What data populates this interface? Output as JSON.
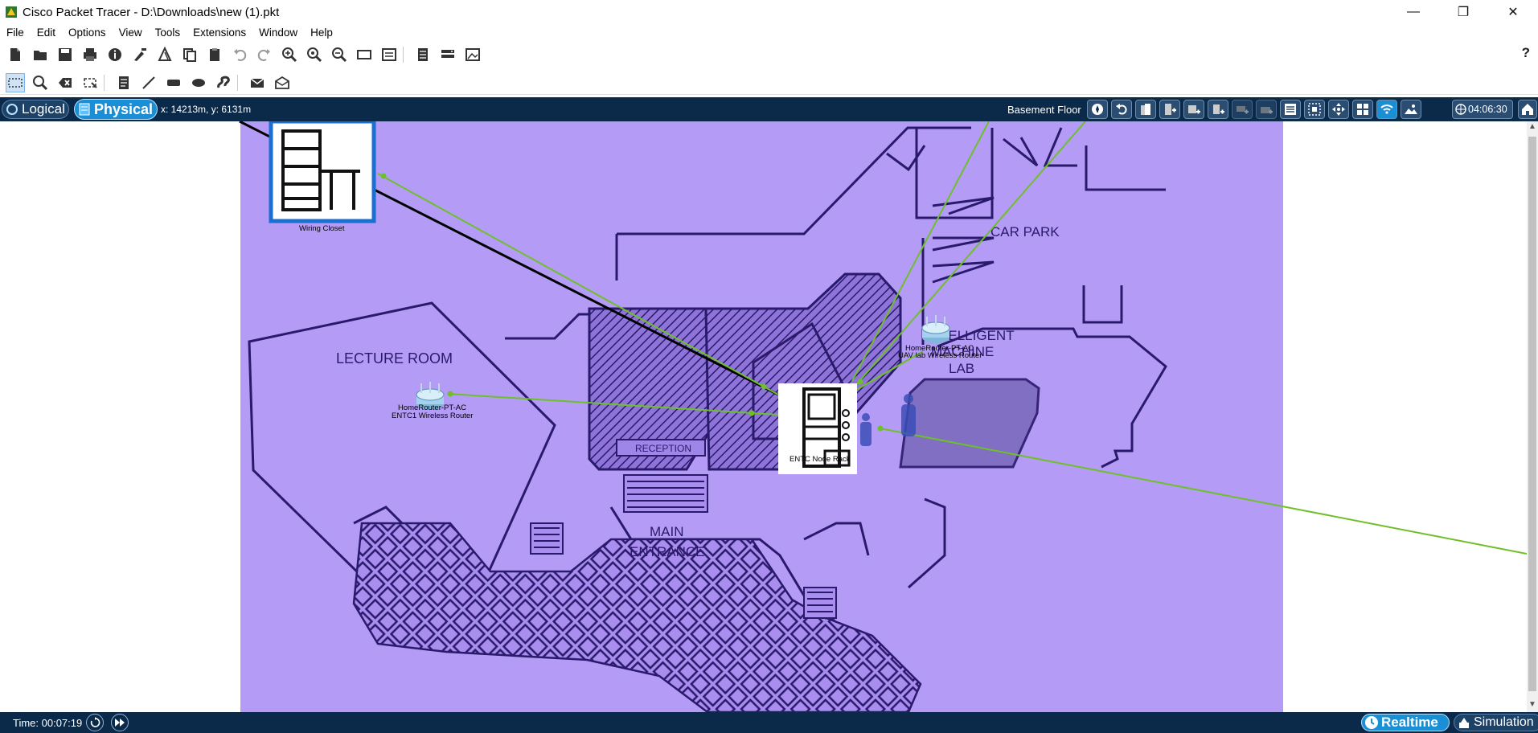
{
  "window": {
    "title": "Cisco Packet Tracer - D:\\Downloads\\new (1).pkt",
    "controls": [
      "minimize-icon",
      "restore-icon",
      "close-icon"
    ]
  },
  "menu": [
    "File",
    "Edit",
    "Options",
    "View",
    "Tools",
    "Extensions",
    "Window",
    "Help"
  ],
  "toolbar1": [
    "new-file-icon",
    "open-folder-icon",
    "save-icon",
    "print-icon",
    "info-icon",
    "activity-wizard-icon",
    "custom-device-icon",
    "copy-icon",
    "paste-icon",
    "undo-icon",
    "redo-icon",
    "zoom-in-icon",
    "zoom-reset-icon",
    "zoom-out-icon",
    "drawing-palette-icon",
    "custom-devices-dialog-icon",
    "viewport-icon",
    "cluster-icon",
    "network-info-icon"
  ],
  "toolbar2": [
    "select-icon",
    "inspect-icon",
    "delete-icon",
    "resize-shape-icon",
    "place-note-icon",
    "draw-line-icon",
    "draw-rectangle-icon",
    "draw-ellipse-icon",
    "freeform-icon",
    "add-simple-pdu-icon",
    "add-complex-pdu-icon"
  ],
  "nav": {
    "logical_label": "Logical",
    "physical_label": "Physical",
    "coords": "x: 14213m, y: 6131m",
    "floor_label": "Basement Floor",
    "clock": "04:06:30",
    "icons": [
      "navigation-icon",
      "back-icon",
      "new-building-icon",
      "new-closet-icon",
      "new-rack-icon",
      "new-wiring-icon",
      "new-table-icon",
      "move-object-icon",
      "grid-icon",
      "tile-icon",
      "set-background-icon",
      "wireless-icon",
      "cluster-view-icon"
    ]
  },
  "map": {
    "labels": {
      "lecture_room": "LECTURE ROOM",
      "car_park": "CAR PARK",
      "reception": "RECEPTION",
      "intelligent": "INTELLIGENT",
      "machine": "MACHINE",
      "lab": "LAB",
      "main": "MAIN",
      "entrance": "ENTRANCE"
    },
    "devices": {
      "wiring_closet": "Wiring Closet",
      "entc_router_model": "HomeRouter-PT-AC",
      "entc_router_name": "ENTC1 Wireless Router",
      "uav_router_model": "HomeRouter-PT-AC",
      "uav_router_name": "UAV lab Wireless Router",
      "node_rack": "ENTC Node Rack"
    },
    "colors": {
      "background": "#b49cf6",
      "lines": "#2a1a6b",
      "wireless_link": "#6fbf2a",
      "wired_link": "#000000"
    }
  },
  "status": {
    "time": "Time: 00:07:19",
    "realtime_label": "Realtime",
    "simulation_label": "Simulation",
    "buttons": [
      "power-cycle-icon",
      "fast-forward-icon"
    ]
  }
}
